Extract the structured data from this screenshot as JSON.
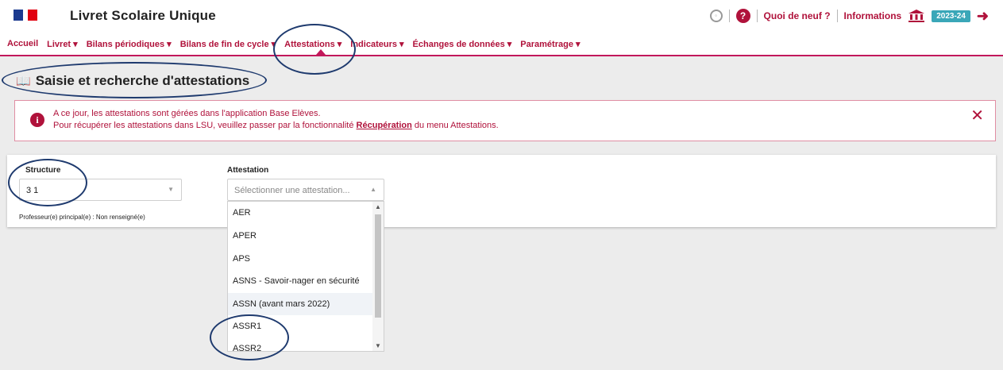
{
  "header": {
    "app_title": "Livret Scolaire Unique",
    "whats_new": "Quoi de neuf ?",
    "informations": "Informations",
    "school_year": "2023-24",
    "icons": [
      "headset-icon",
      "help-icon",
      "bank-icon",
      "logout-icon"
    ]
  },
  "nav": {
    "items": [
      {
        "label": "Accueil"
      },
      {
        "label": "Livret ▾"
      },
      {
        "label": "Bilans périodiques ▾"
      },
      {
        "label": "Bilans de fin de cycle ▾"
      },
      {
        "label": "Attestations ▾"
      },
      {
        "label": "Indicateurs ▾"
      },
      {
        "label": "Échanges de données ▾"
      },
      {
        "label": "Paramétrage ▾"
      }
    ],
    "active_index": 4
  },
  "page": {
    "title": "Saisie et recherche d'attestations"
  },
  "alert": {
    "line1": "A ce jour, les attestations sont gérées dans l'application Base Elèves.",
    "line2_before": "Pour récupérer les attestations dans LSU, veuillez passer par la fonctionnalité ",
    "line2_link": "Récupération",
    "line2_after": " du menu Attestations.",
    "close": "✕"
  },
  "form": {
    "structure_label": "Structure",
    "structure_value": "3 1",
    "professor_note": "Professeur(e) principal(e) : Non renseigné(e)",
    "attestation_label": "Attestation",
    "attestation_placeholder": "Sélectionner une attestation...",
    "options": [
      {
        "label": "AER",
        "highlighted": false
      },
      {
        "label": "APER",
        "highlighted": false
      },
      {
        "label": "APS",
        "highlighted": false
      },
      {
        "label": "ASNS - Savoir-nager en sécurité",
        "highlighted": false
      },
      {
        "label": "ASSN (avant mars 2022)",
        "highlighted": true
      },
      {
        "label": "ASSR1",
        "highlighted": false
      },
      {
        "label": "ASSR2",
        "highlighted": false
      }
    ]
  },
  "colors": {
    "brand": "#b0123b",
    "badge": "#3aa7b8",
    "annotation": "#1e3a6e"
  }
}
